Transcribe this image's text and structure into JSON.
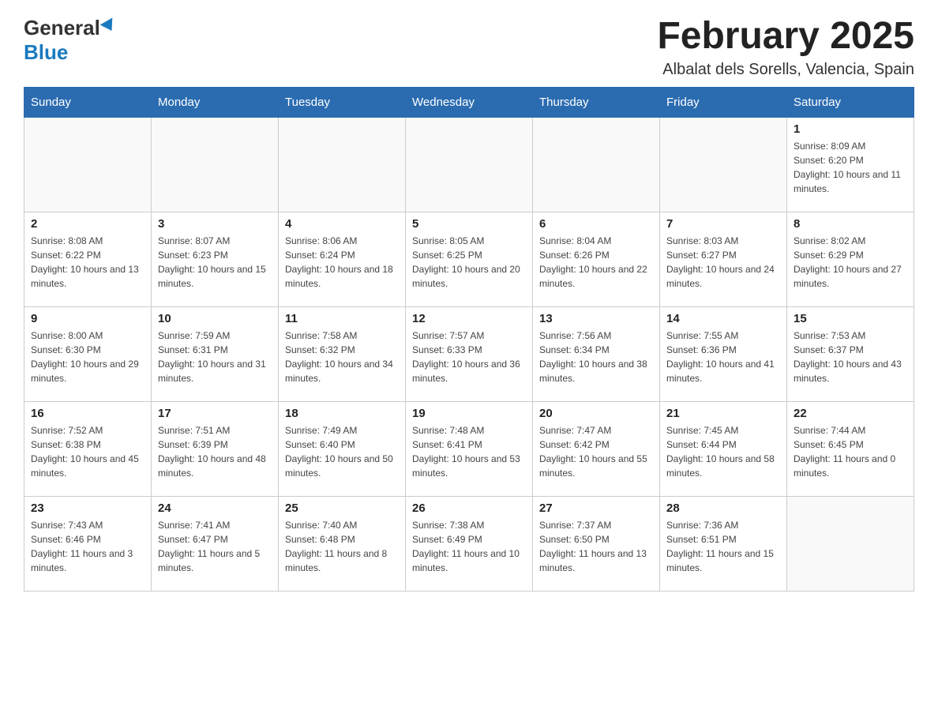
{
  "header": {
    "logo_general": "General",
    "logo_blue": "Blue",
    "title": "February 2025",
    "subtitle": "Albalat dels Sorells, Valencia, Spain"
  },
  "days_of_week": [
    "Sunday",
    "Monday",
    "Tuesday",
    "Wednesday",
    "Thursday",
    "Friday",
    "Saturday"
  ],
  "weeks": [
    [
      {
        "day": "",
        "sunrise": "",
        "sunset": "",
        "daylight": ""
      },
      {
        "day": "",
        "sunrise": "",
        "sunset": "",
        "daylight": ""
      },
      {
        "day": "",
        "sunrise": "",
        "sunset": "",
        "daylight": ""
      },
      {
        "day": "",
        "sunrise": "",
        "sunset": "",
        "daylight": ""
      },
      {
        "day": "",
        "sunrise": "",
        "sunset": "",
        "daylight": ""
      },
      {
        "day": "",
        "sunrise": "",
        "sunset": "",
        "daylight": ""
      },
      {
        "day": "1",
        "sunrise": "Sunrise: 8:09 AM",
        "sunset": "Sunset: 6:20 PM",
        "daylight": "Daylight: 10 hours and 11 minutes."
      }
    ],
    [
      {
        "day": "2",
        "sunrise": "Sunrise: 8:08 AM",
        "sunset": "Sunset: 6:22 PM",
        "daylight": "Daylight: 10 hours and 13 minutes."
      },
      {
        "day": "3",
        "sunrise": "Sunrise: 8:07 AM",
        "sunset": "Sunset: 6:23 PM",
        "daylight": "Daylight: 10 hours and 15 minutes."
      },
      {
        "day": "4",
        "sunrise": "Sunrise: 8:06 AM",
        "sunset": "Sunset: 6:24 PM",
        "daylight": "Daylight: 10 hours and 18 minutes."
      },
      {
        "day": "5",
        "sunrise": "Sunrise: 8:05 AM",
        "sunset": "Sunset: 6:25 PM",
        "daylight": "Daylight: 10 hours and 20 minutes."
      },
      {
        "day": "6",
        "sunrise": "Sunrise: 8:04 AM",
        "sunset": "Sunset: 6:26 PM",
        "daylight": "Daylight: 10 hours and 22 minutes."
      },
      {
        "day": "7",
        "sunrise": "Sunrise: 8:03 AM",
        "sunset": "Sunset: 6:27 PM",
        "daylight": "Daylight: 10 hours and 24 minutes."
      },
      {
        "day": "8",
        "sunrise": "Sunrise: 8:02 AM",
        "sunset": "Sunset: 6:29 PM",
        "daylight": "Daylight: 10 hours and 27 minutes."
      }
    ],
    [
      {
        "day": "9",
        "sunrise": "Sunrise: 8:00 AM",
        "sunset": "Sunset: 6:30 PM",
        "daylight": "Daylight: 10 hours and 29 minutes."
      },
      {
        "day": "10",
        "sunrise": "Sunrise: 7:59 AM",
        "sunset": "Sunset: 6:31 PM",
        "daylight": "Daylight: 10 hours and 31 minutes."
      },
      {
        "day": "11",
        "sunrise": "Sunrise: 7:58 AM",
        "sunset": "Sunset: 6:32 PM",
        "daylight": "Daylight: 10 hours and 34 minutes."
      },
      {
        "day": "12",
        "sunrise": "Sunrise: 7:57 AM",
        "sunset": "Sunset: 6:33 PM",
        "daylight": "Daylight: 10 hours and 36 minutes."
      },
      {
        "day": "13",
        "sunrise": "Sunrise: 7:56 AM",
        "sunset": "Sunset: 6:34 PM",
        "daylight": "Daylight: 10 hours and 38 minutes."
      },
      {
        "day": "14",
        "sunrise": "Sunrise: 7:55 AM",
        "sunset": "Sunset: 6:36 PM",
        "daylight": "Daylight: 10 hours and 41 minutes."
      },
      {
        "day": "15",
        "sunrise": "Sunrise: 7:53 AM",
        "sunset": "Sunset: 6:37 PM",
        "daylight": "Daylight: 10 hours and 43 minutes."
      }
    ],
    [
      {
        "day": "16",
        "sunrise": "Sunrise: 7:52 AM",
        "sunset": "Sunset: 6:38 PM",
        "daylight": "Daylight: 10 hours and 45 minutes."
      },
      {
        "day": "17",
        "sunrise": "Sunrise: 7:51 AM",
        "sunset": "Sunset: 6:39 PM",
        "daylight": "Daylight: 10 hours and 48 minutes."
      },
      {
        "day": "18",
        "sunrise": "Sunrise: 7:49 AM",
        "sunset": "Sunset: 6:40 PM",
        "daylight": "Daylight: 10 hours and 50 minutes."
      },
      {
        "day": "19",
        "sunrise": "Sunrise: 7:48 AM",
        "sunset": "Sunset: 6:41 PM",
        "daylight": "Daylight: 10 hours and 53 minutes."
      },
      {
        "day": "20",
        "sunrise": "Sunrise: 7:47 AM",
        "sunset": "Sunset: 6:42 PM",
        "daylight": "Daylight: 10 hours and 55 minutes."
      },
      {
        "day": "21",
        "sunrise": "Sunrise: 7:45 AM",
        "sunset": "Sunset: 6:44 PM",
        "daylight": "Daylight: 10 hours and 58 minutes."
      },
      {
        "day": "22",
        "sunrise": "Sunrise: 7:44 AM",
        "sunset": "Sunset: 6:45 PM",
        "daylight": "Daylight: 11 hours and 0 minutes."
      }
    ],
    [
      {
        "day": "23",
        "sunrise": "Sunrise: 7:43 AM",
        "sunset": "Sunset: 6:46 PM",
        "daylight": "Daylight: 11 hours and 3 minutes."
      },
      {
        "day": "24",
        "sunrise": "Sunrise: 7:41 AM",
        "sunset": "Sunset: 6:47 PM",
        "daylight": "Daylight: 11 hours and 5 minutes."
      },
      {
        "day": "25",
        "sunrise": "Sunrise: 7:40 AM",
        "sunset": "Sunset: 6:48 PM",
        "daylight": "Daylight: 11 hours and 8 minutes."
      },
      {
        "day": "26",
        "sunrise": "Sunrise: 7:38 AM",
        "sunset": "Sunset: 6:49 PM",
        "daylight": "Daylight: 11 hours and 10 minutes."
      },
      {
        "day": "27",
        "sunrise": "Sunrise: 7:37 AM",
        "sunset": "Sunset: 6:50 PM",
        "daylight": "Daylight: 11 hours and 13 minutes."
      },
      {
        "day": "28",
        "sunrise": "Sunrise: 7:36 AM",
        "sunset": "Sunset: 6:51 PM",
        "daylight": "Daylight: 11 hours and 15 minutes."
      },
      {
        "day": "",
        "sunrise": "",
        "sunset": "",
        "daylight": ""
      }
    ]
  ]
}
